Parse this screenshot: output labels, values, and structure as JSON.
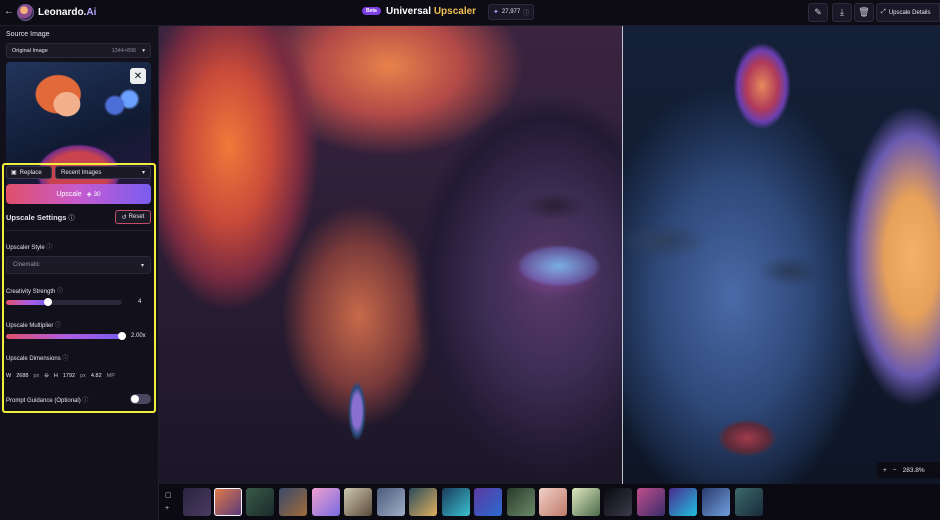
{
  "topbar": {
    "back_icon": "arrow-left",
    "brand_name": "Leonardo.",
    "brand_suffix": "Ai",
    "beta_badge": "Beta",
    "title_part1": "Universal",
    "title_part2": "Upscaler",
    "credits": "27,977",
    "upscale_details_label": "Upscale Details"
  },
  "sidebar": {
    "source_image_label": "Source Image",
    "source_select_value": "Original Image",
    "source_select_dims": "1344×896",
    "replace_label": "Replace",
    "recent_images_label": "Recent Images",
    "upscale_button_label": "Upscale",
    "upscale_cost": "30",
    "settings_title": "Upscale Settings",
    "reset_label": "Reset",
    "style_label": "Upscaler Style",
    "style_value": "Cinematic",
    "creativity_label": "Creativity Strength",
    "creativity_value": "4",
    "creativity_fraction": 0.36,
    "multiplier_label": "Upscale Multiplier",
    "multiplier_value": "2.00x",
    "multiplier_fraction": 1.0,
    "dimensions_label": "Upscale Dimensions",
    "dim_w_label": "W",
    "dim_w_value": "2688",
    "dim_h_label": "H",
    "dim_h_value": "1792",
    "dim_unit": "px",
    "dim_mp_value": "4.82",
    "dim_mp_unit": "MP",
    "prompt_guidance_label": "Prompt Guidance (Optional)",
    "prompt_guidance_on": false
  },
  "viewer": {
    "zoom_plus": "+",
    "zoom_minus": "−",
    "zoom_value": "283.8%"
  },
  "colors": {
    "accent_gradient_start": "#e0506a",
    "accent_gradient_end": "#7a5cf0",
    "highlight_box": "#f1ee3e",
    "title_highlight": "#f0c050"
  }
}
